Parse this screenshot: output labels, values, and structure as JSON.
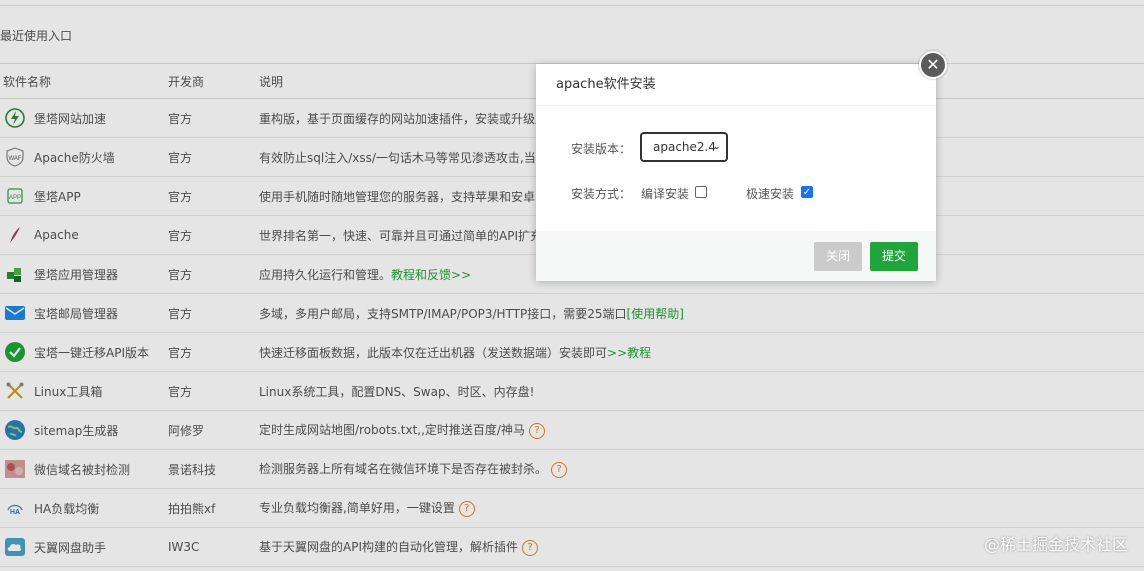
{
  "recent_title": "最近使用入口",
  "table": {
    "headers": [
      "软件名称",
      "开发商",
      "说明"
    ],
    "rows": [
      {
        "icon": "bolt-icon",
        "name": "堡塔网站加速",
        "vendor": "官方",
        "desc": "重构版，基于页面缓存的网站加速插件，安装或升级后需要重启面板才能生效",
        "link": "",
        "help": false
      },
      {
        "icon": "waf-icon",
        "name": "Apache防火墙",
        "vendor": "官方",
        "desc": "有效防止sql注入/xss/一句话木马等常见渗透攻击,当前版本支持",
        "link": "",
        "help": false
      },
      {
        "icon": "app-icon",
        "name": "堡塔APP",
        "vendor": "官方",
        "desc": "使用手机随时随地管理您的服务器，支持苹果和安卓",
        "link": "",
        "help": false
      },
      {
        "icon": "apache-feather-icon",
        "name": "Apache",
        "vendor": "官方",
        "desc": "世界排名第一，快速、可靠并且可通过简单的API扩充",
        "link": "",
        "help": false
      },
      {
        "icon": "cubes-icon",
        "name": "堡塔应用管理器",
        "vendor": "官方",
        "desc": "应用持久化运行和管理。",
        "link": "教程和反馈>>",
        "help": false
      },
      {
        "icon": "mail-icon",
        "name": "宝塔邮局管理器",
        "vendor": "官方",
        "desc": "多域，多用户邮局，支持SMTP/IMAP/POP3/HTTP接口，需要25端口",
        "link": "[使用帮助]",
        "help": false
      },
      {
        "icon": "check-circle-icon",
        "name": "宝塔一键迁移API版本",
        "vendor": "官方",
        "desc": "快速迁移面板数据，此版本仅在迁出机器（发送数据端）安装即可",
        "link": ">>教程",
        "help": false
      },
      {
        "icon": "tools-icon",
        "name": "Linux工具箱",
        "vendor": "官方",
        "desc": "Linux系统工具，配置DNS、Swap、时区、内存盘!",
        "link": "",
        "help": false
      },
      {
        "icon": "globe-icon",
        "name": "sitemap生成器",
        "vendor": "阿修罗",
        "desc": "定时生成网站地图/robots.txt,,定时推送百度/神马",
        "link": "",
        "help": true
      },
      {
        "icon": "wechat-check-icon",
        "name": "微信域名被封检测",
        "vendor": "景诺科技",
        "desc": "检测服务器上所有域名在微信环境下是否存在被封杀。",
        "link": "",
        "help": true
      },
      {
        "icon": "ha-icon",
        "name": "HA负载均衡",
        "vendor": "拍拍熊xf",
        "desc": "专业负载均衡器,简单好用，一键设置",
        "link": "",
        "help": true
      },
      {
        "icon": "cloud-icon",
        "name": "天翼网盘助手",
        "vendor": "IW3C",
        "desc": "基于天翼网盘的API构建的自动化管理，解析插件",
        "link": "",
        "help": true
      }
    ]
  },
  "modal": {
    "title": "apache软件安装",
    "version_label": "安装版本：",
    "version_value": "apache2.4",
    "method_label": "安装方式：",
    "compile_label": "编译安装",
    "compile_checked": false,
    "fast_label": "极速安装",
    "fast_checked": true,
    "close_label": "关闭",
    "submit_label": "提交",
    "close_icon": "close-icon"
  },
  "watermark": "@稀土掘金技术社区",
  "colors": {
    "accent": "#20a53a",
    "help": "#e0872a",
    "checkbox": "#1a73e8"
  }
}
